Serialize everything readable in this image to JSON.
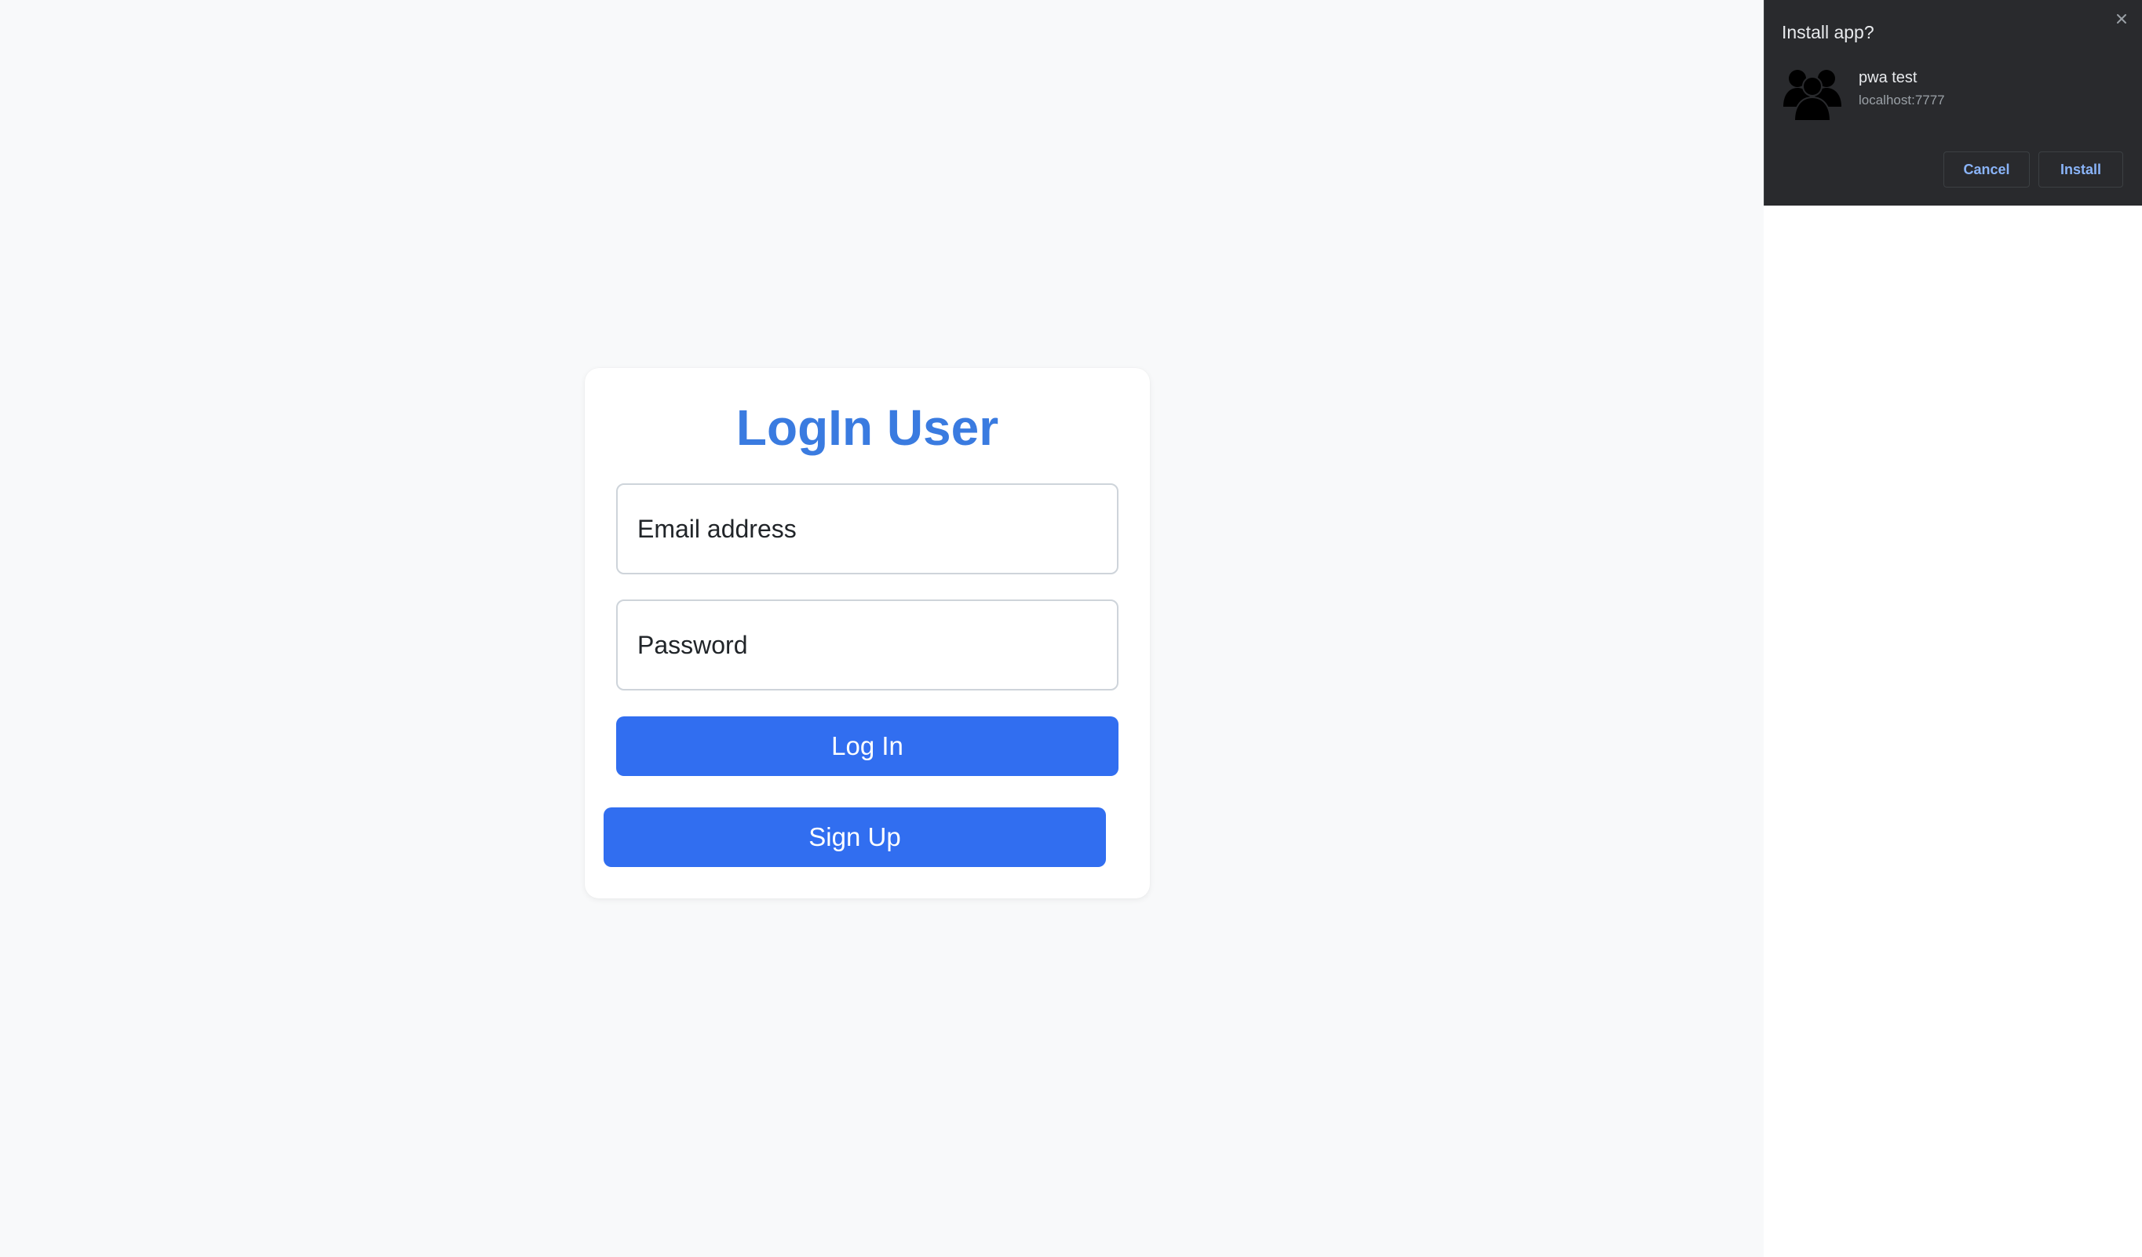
{
  "login": {
    "title": "LogIn User",
    "email_placeholder": "Email address",
    "password_placeholder": "Password",
    "login_label": "Log In",
    "signup_label": "Sign Up"
  },
  "install_popup": {
    "title": "Install app?",
    "app_name": "pwa test",
    "origin": "localhost:7777",
    "cancel_label": "Cancel",
    "install_label": "Install",
    "close_icon": "close-icon",
    "app_icon": "users-group-icon"
  },
  "colors": {
    "page_bg": "#f8f9fa",
    "title": "#3a7be0",
    "button": "#316ef0",
    "popup_bg": "#292a2d",
    "popup_button_text": "#8ab4f8"
  }
}
